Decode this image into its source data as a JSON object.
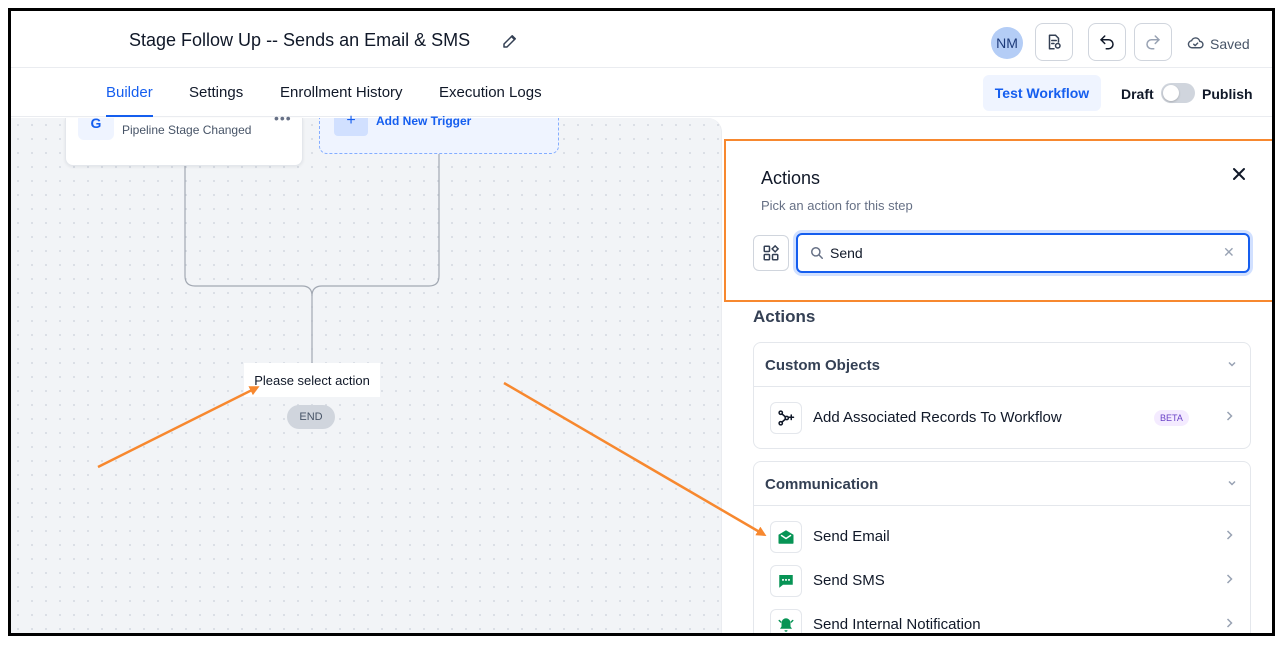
{
  "header": {
    "title": "Stage Follow Up -- Sends an Email & SMS",
    "avatar_initials": "NM",
    "saved_label": "Saved"
  },
  "tabs": [
    {
      "label": "Builder",
      "active": true
    },
    {
      "label": "Settings",
      "active": false
    },
    {
      "label": "Enrollment History",
      "active": false
    },
    {
      "label": "Execution Logs",
      "active": false
    }
  ],
  "toolbar": {
    "test_workflow_label": "Test Workflow",
    "draft_label": "Draft",
    "publish_label": "Publish",
    "publish_toggle_on": false
  },
  "canvas": {
    "trigger_label": "Pipeline Stage Changed",
    "add_trigger_label": "Add New Trigger",
    "action_placeholder": "Please select action",
    "end_label": "END"
  },
  "panel": {
    "title": "Actions",
    "subtitle": "Pick an action for this step",
    "search_value": "Send",
    "section_heading": "Actions",
    "groups": [
      {
        "title": "Custom Objects",
        "items": [
          {
            "label": "Add Associated Records To Workflow",
            "badge": "BETA",
            "icon": "associated-records-icon"
          }
        ]
      },
      {
        "title": "Communication",
        "items": [
          {
            "label": "Send Email",
            "icon": "email-icon"
          },
          {
            "label": "Send SMS",
            "icon": "sms-icon"
          },
          {
            "label": "Send Internal Notification",
            "icon": "bell-icon"
          }
        ]
      }
    ]
  },
  "colors": {
    "primary": "#155eef",
    "annotation": "#f7882f",
    "icon_green": "#079455"
  }
}
